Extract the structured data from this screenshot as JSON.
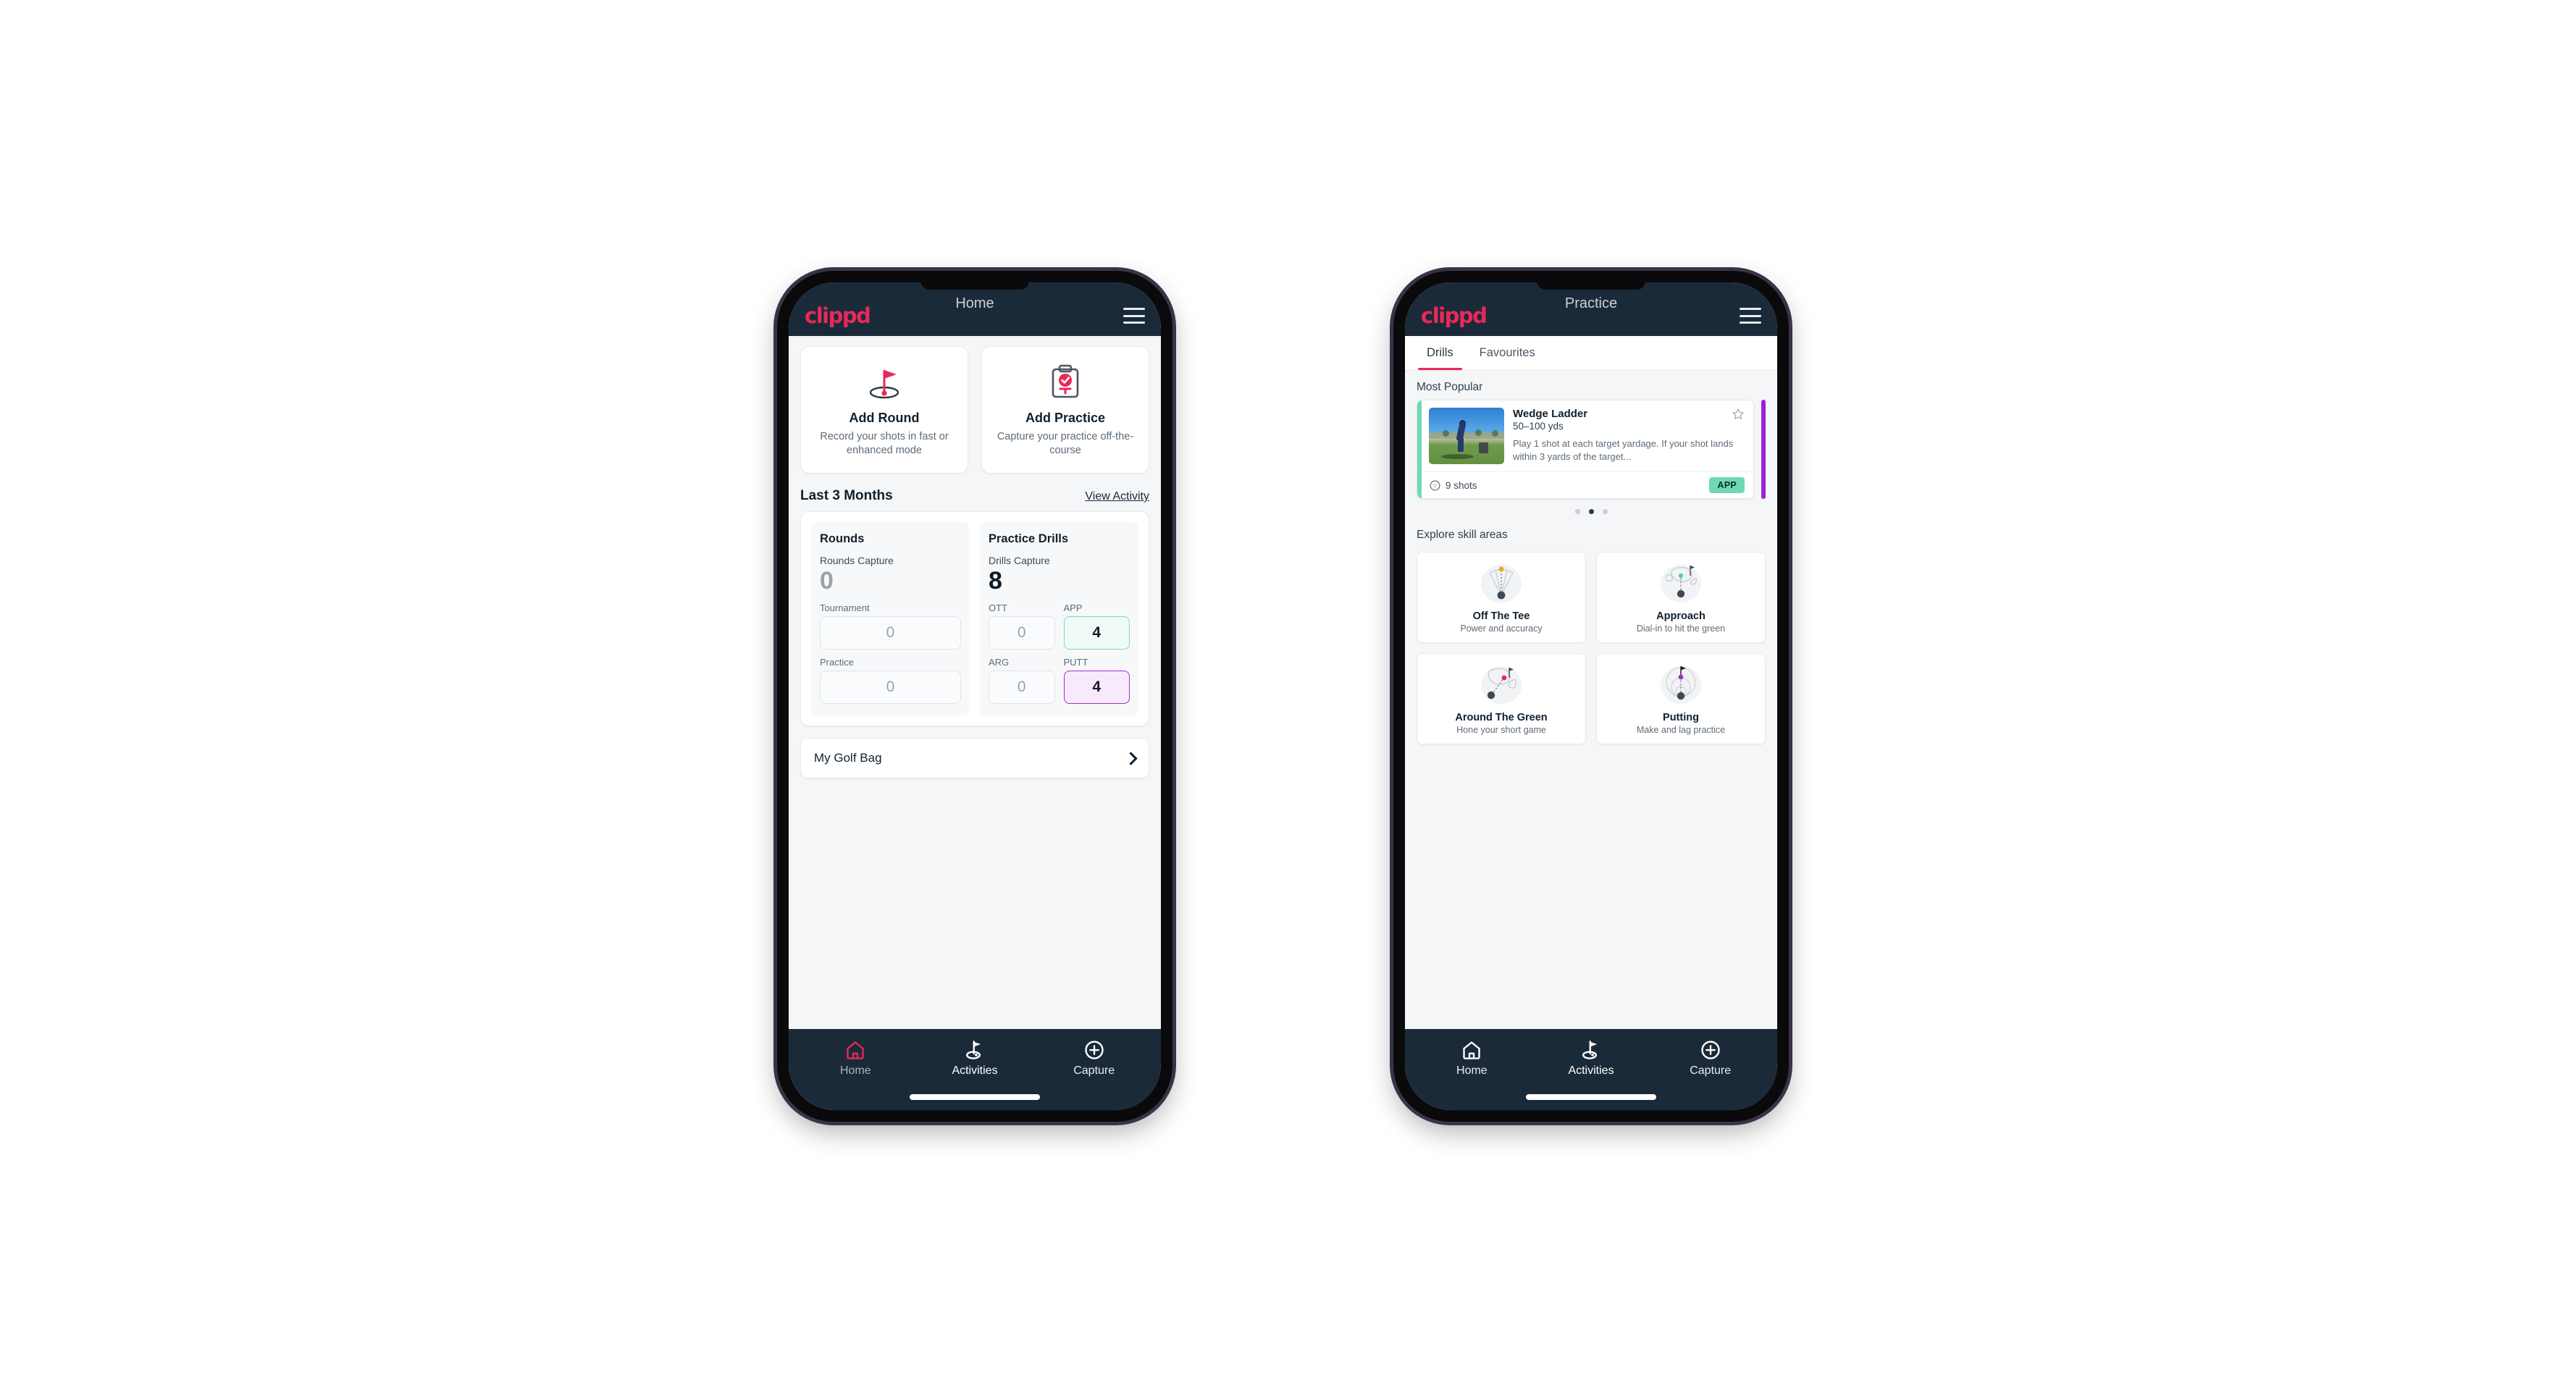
{
  "colors": {
    "appbar_bg": "#1b2a38",
    "brand_pink": "#e8295a",
    "page_bg": "#f4f6f8",
    "app_green": "#6fd8b6",
    "putt_purple": "#a32ecd",
    "peek_purple": "#9b23d6",
    "tab_underline": "#e8295a"
  },
  "phone_home": {
    "appbar": {
      "logo": "clippd",
      "title": "Home",
      "menu_icon": "hamburger-icon"
    },
    "quick_actions": [
      {
        "icon": "golf-flag-hole-icon",
        "title": "Add Round",
        "subtitle": "Record your shots in fast or enhanced mode"
      },
      {
        "icon": "clipboard-check-tee-icon",
        "title": "Add Practice",
        "subtitle": "Capture your practice off-the-course"
      }
    ],
    "section": {
      "title": "Last 3 Months",
      "link": "View Activity"
    },
    "rounds": {
      "heading": "Rounds",
      "capture_label": "Rounds Capture",
      "capture_value": "0",
      "fields": [
        {
          "label": "Tournament",
          "value": "0",
          "highlight": "none"
        },
        {
          "label": "Practice",
          "value": "0",
          "highlight": "none"
        }
      ]
    },
    "drills": {
      "heading": "Practice Drills",
      "capture_label": "Drills Capture",
      "capture_value": "8",
      "fields": [
        {
          "label": "OTT",
          "value": "0",
          "highlight": "none"
        },
        {
          "label": "APP",
          "value": "4",
          "highlight": "green"
        },
        {
          "label": "ARG",
          "value": "0",
          "highlight": "none"
        },
        {
          "label": "PUTT",
          "value": "4",
          "highlight": "purple"
        }
      ]
    },
    "golf_bag": {
      "label": "My Golf Bag",
      "chevron_icon": "chevron-right-icon"
    },
    "bottom_nav": [
      {
        "icon": "home-icon",
        "label": "Home",
        "state": "active-pink"
      },
      {
        "icon": "golf-flag-icon",
        "label": "Activities",
        "state": "default"
      },
      {
        "icon": "plus-circle-icon",
        "label": "Capture",
        "state": "default"
      }
    ]
  },
  "phone_practice": {
    "appbar": {
      "logo": "clippd",
      "title": "Practice",
      "menu_icon": "hamburger-icon"
    },
    "tabs": [
      {
        "label": "Drills",
        "active": true
      },
      {
        "label": "Favourites",
        "active": false
      }
    ],
    "most_popular": {
      "heading": "Most Popular",
      "card": {
        "stripe_color": "#6fd8b6",
        "thumbnail": "golfer-chipping-photo",
        "title": "Wedge Ladder",
        "yards": "50–100 yds",
        "description": "Play 1 shot at each target yardage. If your shot lands within 3 yards of the target...",
        "favourite_icon": "star-outline-icon",
        "shots_icon": "golf-ball-icon",
        "shots": "9 shots",
        "badge": "APP"
      },
      "peek_card_color": "#9b23d6",
      "dots": {
        "count": 3,
        "active_index": 1
      }
    },
    "skill_areas": {
      "heading": "Explore skill areas",
      "items": [
        {
          "icon": "tee-shot-fan-icon",
          "name": "Off The Tee",
          "sub": "Power and accuracy",
          "accent": "#f0a92b"
        },
        {
          "icon": "green-approach-icon",
          "name": "Approach",
          "sub": "Dial-in to hit the green",
          "accent": "#4fd3ae"
        },
        {
          "icon": "chip-around-green-icon",
          "name": "Around The Green",
          "sub": "Hone your short game",
          "accent": "#e8295a"
        },
        {
          "icon": "putting-rings-icon",
          "name": "Putting",
          "sub": "Make and lag practice",
          "accent": "#a32ecd"
        }
      ]
    },
    "bottom_nav": [
      {
        "icon": "home-icon",
        "label": "Home",
        "state": "default"
      },
      {
        "icon": "golf-flag-icon",
        "label": "Activities",
        "state": "default"
      },
      {
        "icon": "plus-circle-icon",
        "label": "Capture",
        "state": "default"
      }
    ]
  }
}
